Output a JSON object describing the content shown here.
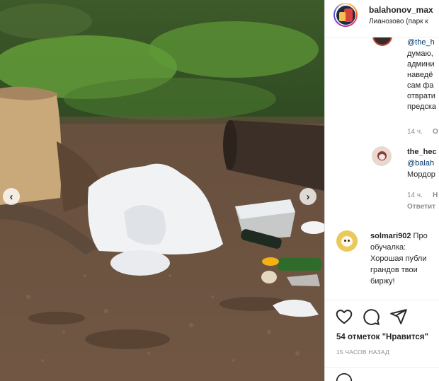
{
  "post": {
    "username": "balahonov_max",
    "location": "Лианозово (парк к"
  },
  "photo": {
    "description_icon": "photo",
    "prev_icon": "chevron-left-icon",
    "next_icon": "chevron-right-icon",
    "prev_glyph": "‹",
    "next_glyph": "›"
  },
  "comments": [
    {
      "mention": "@the_h",
      "lines": [
        "думаю,",
        "админи",
        "наведё",
        "сам фа",
        "отврати",
        "предска"
      ],
      "time": "14 ч.",
      "action": "О"
    },
    {
      "username": "the_hec",
      "mention": "@balah",
      "line": "Мордор",
      "time": "14 ч.",
      "likes": "Н",
      "reply_label": "Ответит"
    },
    {
      "username": "solmari902",
      "first_text": " Про",
      "lines": [
        "обучалка:",
        "Хорошая публи",
        "грандов твои ",
        "биржу!"
      ]
    }
  ],
  "actions": {
    "like_icon": "heart-icon",
    "comment_icon": "comment-icon",
    "share_icon": "share-icon",
    "likes_text": "54 отметок \"Нравится\"",
    "posted_ago": "15 ЧАСОВ НАЗАД"
  },
  "colors": {
    "link": "#00376b",
    "meta": "#8e8e8e",
    "text": "#262626"
  }
}
